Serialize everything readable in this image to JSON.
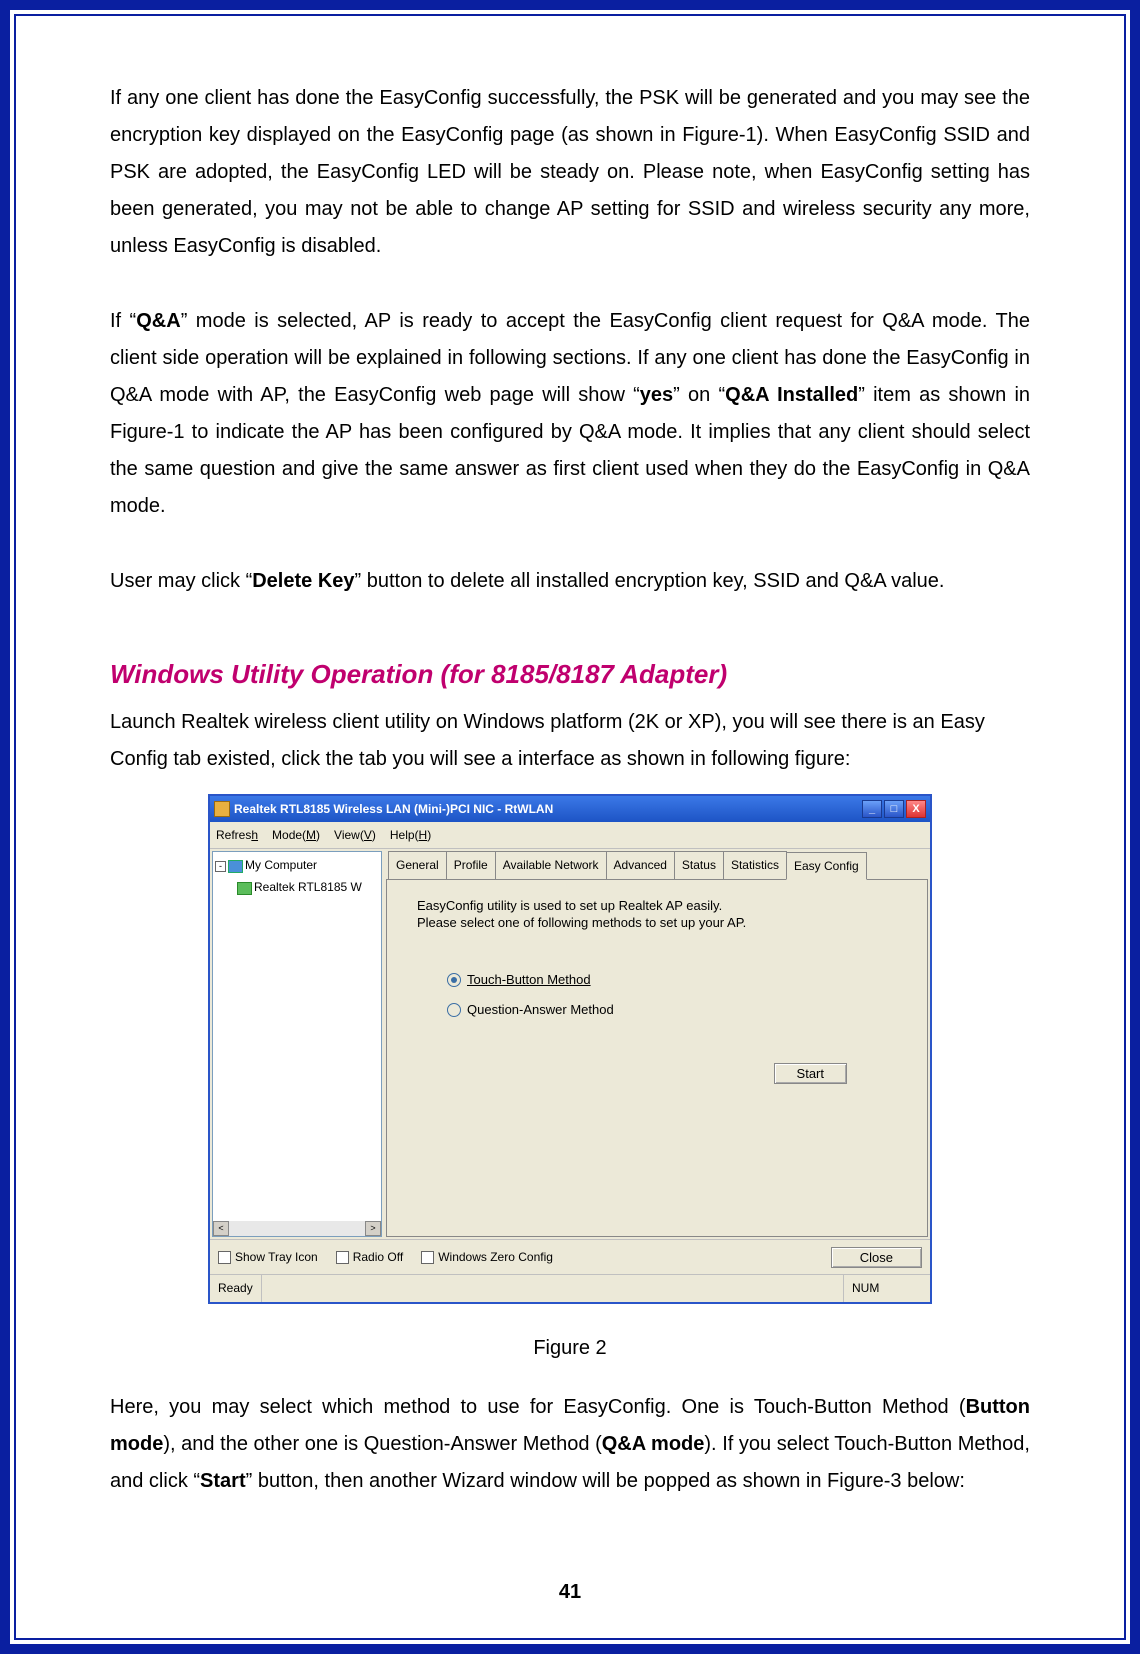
{
  "para1_a": "If any one client has done the EasyConfig successfully, the PSK will be generated and you may see the encryption key displayed on the EasyConfig page (as shown in Figure-1). When EasyConfig SSID and PSK are adopted, the EasyConfig LED will be steady on. Please note, when EasyConfig setting has been generated, you may not be able to change AP setting for SSID and wireless security any more, unless EasyConfig is disabled.",
  "para2": {
    "a": "If “",
    "qa": "Q&A",
    "b": "” mode is selected, AP is ready to accept the EasyConfig client request for Q&A mode. The client side operation will be explained in following sections. If any one client has done the EasyConfig in Q&A mode with AP, the EasyConfig web page will show “",
    "yes": "yes",
    "c": "” on “",
    "qai": "Q&A Installed",
    "d": "” item as shown in Figure-1 to indicate the AP has been configured by Q&A mode. It implies that any client should select the same question and give the same answer as first client used when they do the EasyConfig in Q&A mode."
  },
  "para3": {
    "a": "User may click “",
    "dk": "Delete Key",
    "b": "” button to delete all installed encryption key, SSID and Q&A value."
  },
  "section_title": "Windows Utility Operation (for 8185/8187 Adapter)",
  "para4": "Launch Realtek wireless client utility on Windows platform (2K or XP), you will see there is an Easy Config tab existed, click the tab you will see a interface as shown in following figure:",
  "win": {
    "title": "Realtek RTL8185 Wireless LAN (Mini-)PCI NIC - RtWLAN",
    "menu": {
      "refreshPre": "Refres",
      "refreshU": "h",
      "modePre": "Mode(",
      "modeU": "M",
      "modePost": ")",
      "viewPre": "View(",
      "viewU": "V",
      "viewPost": ")",
      "helpPre": "Help(",
      "helpU": "H",
      "helpPost": ")"
    },
    "tree": {
      "root": "My Computer",
      "child": "Realtek RTL8185 W"
    },
    "tabs": [
      "General",
      "Profile",
      "Available Network",
      "Advanced",
      "Status",
      "Statistics",
      "Easy Config"
    ],
    "hint_l1": "EasyConfig utility is used to set up Realtek AP easily.",
    "hint_l2": "Please select one of following methods to set up your AP.",
    "r1": "Touch-Button Method",
    "r2": "Question-Answer Method",
    "start": "Start",
    "cb1": "Show Tray Icon",
    "cb2": "Radio Off",
    "cb3": "Windows Zero Config",
    "close": "Close",
    "status": "Ready",
    "num": "NUM"
  },
  "fig_caption": "Figure 2",
  "para5": {
    "a": "Here, you may select which method to use for EasyConfig. One is Touch-Button Method (",
    "bm": "Button mode",
    "b": "), and the other one is Question-Answer Method (",
    "qm": "Q&A mode",
    "c": "). If you select Touch-Button Method, and click “",
    "start": "Start",
    "d": "” button, then another Wizard window will be popped as shown in Figure-3 below:"
  },
  "page_number": "41"
}
